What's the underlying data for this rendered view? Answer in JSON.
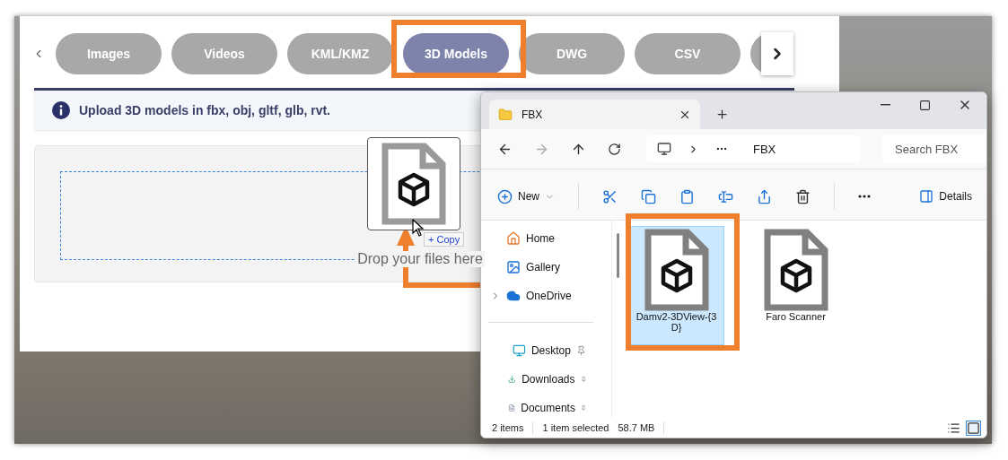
{
  "upload_panel": {
    "tabs": [
      {
        "label": "Images",
        "selected": false
      },
      {
        "label": "Videos",
        "selected": false
      },
      {
        "label": "KML/KMZ",
        "selected": false
      },
      {
        "label": "3D Models",
        "selected": true
      },
      {
        "label": "DWG",
        "selected": false
      },
      {
        "label": "CSV",
        "selected": false
      },
      {
        "selected": false
      }
    ],
    "info": "Upload 3D models in fbx, obj, gltf, glb, rvt.",
    "drop_hint": "Drop your files here"
  },
  "drag_preview": {
    "badge": "+ Copy"
  },
  "explorer": {
    "tab_title": "FBX",
    "breadcrumb": "FBX",
    "search": {
      "placeholder": "Search FBX"
    },
    "new_label": "New",
    "details_label": "Details",
    "nav_groups": [
      [
        {
          "label": "Home",
          "kind": "home",
          "pinned": false,
          "expandable": false
        },
        {
          "label": "Gallery",
          "kind": "gallery",
          "pinned": false,
          "expandable": false
        },
        {
          "label": "OneDrive",
          "kind": "cloud",
          "pinned": false,
          "expandable": true
        }
      ],
      [
        {
          "label": "Desktop",
          "kind": "desktop",
          "pinned": true,
          "expandable": false
        },
        {
          "label": "Downloads",
          "kind": "downloads",
          "pinned": true,
          "expandable": false
        },
        {
          "label": "Documents",
          "kind": "documents",
          "pinned": true,
          "expandable": false
        }
      ]
    ],
    "files": [
      {
        "name": "Damv2-3DView-{3D}",
        "selected": true
      },
      {
        "name": "Faro Scanner",
        "selected": false
      }
    ],
    "status": {
      "count": "2 items",
      "selection": "1 item selected",
      "size": "58.7 MB"
    }
  }
}
